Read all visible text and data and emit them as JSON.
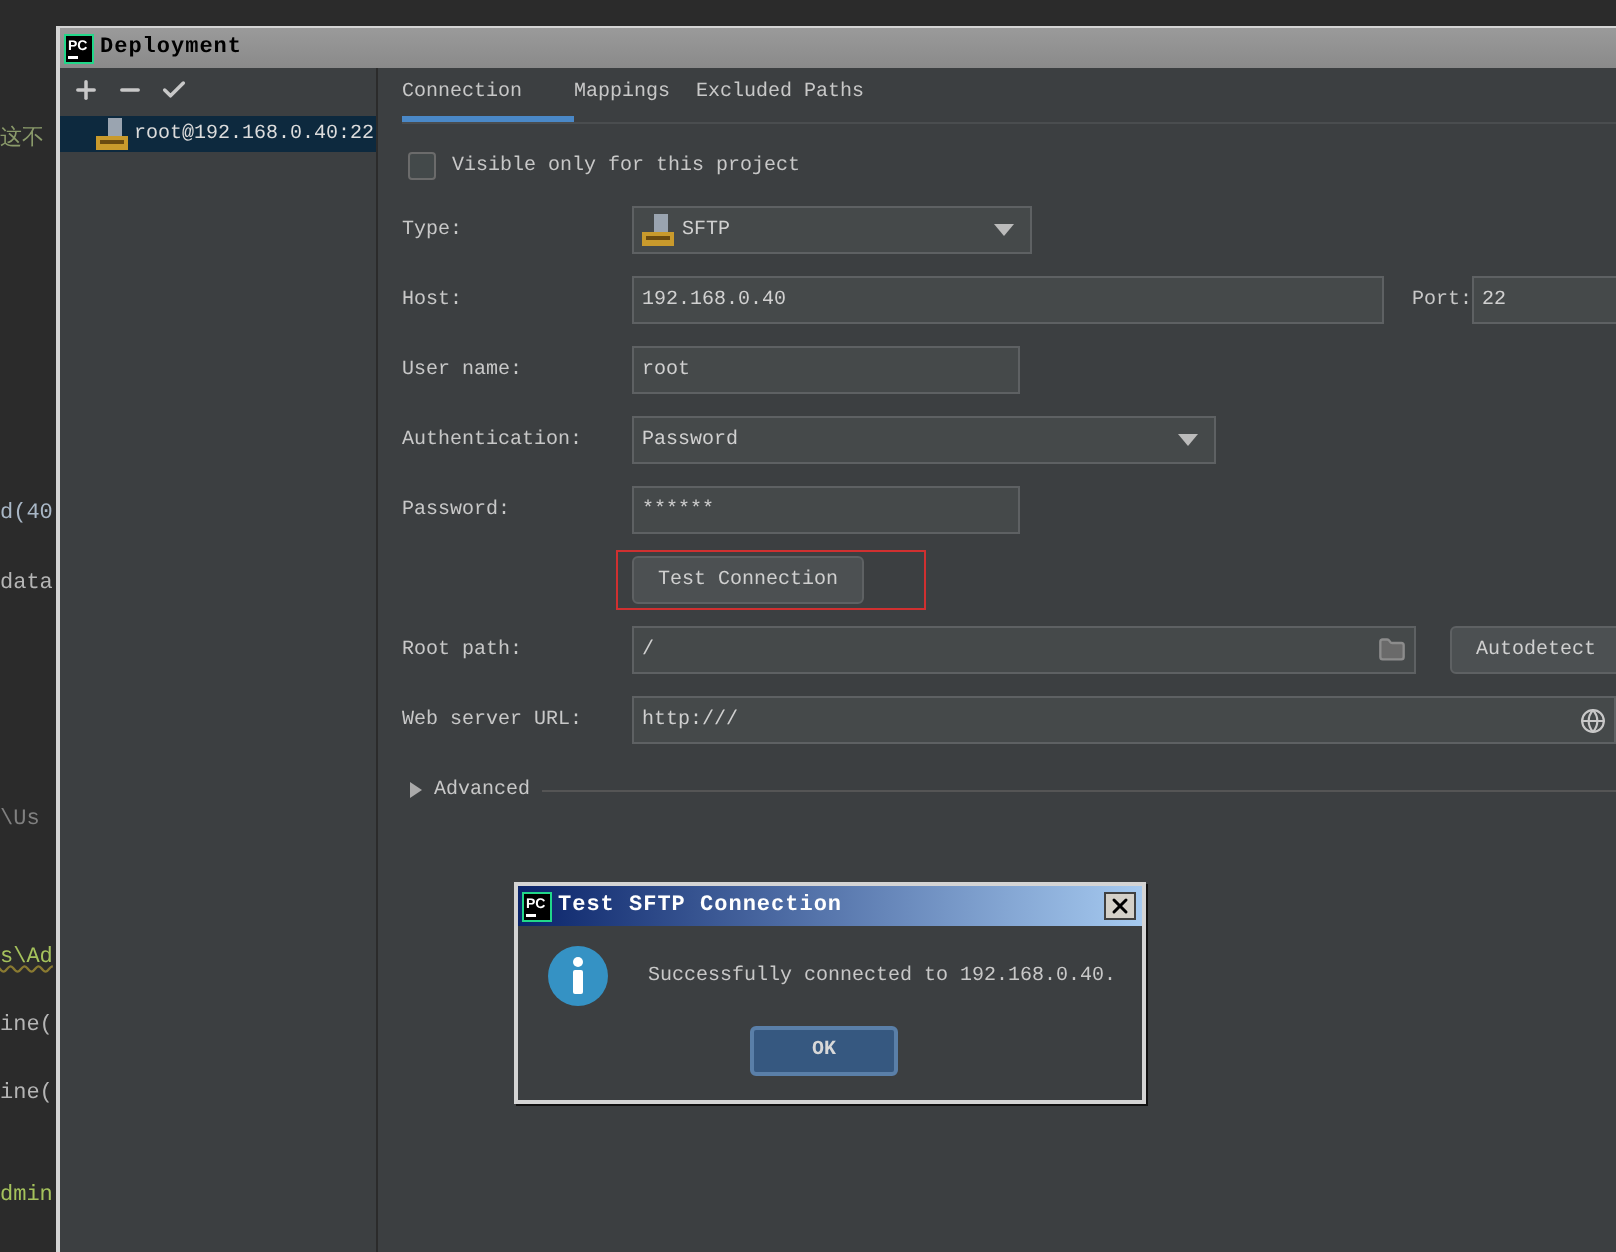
{
  "editor": {
    "fragments": [
      {
        "text": "这不",
        "kind": "comment"
      },
      {
        "text": "d(40",
        "kind": "call"
      },
      {
        "text": "data",
        "kind": "plain"
      },
      {
        "text": "\\Us",
        "kind": "path"
      },
      {
        "text": "s\\Ad",
        "kind": "string"
      },
      {
        "text": "ine(",
        "kind": "plain"
      },
      {
        "text": "ine(",
        "kind": "plain"
      },
      {
        "text": "dmin",
        "kind": "string"
      }
    ]
  },
  "window": {
    "title": "Deployment",
    "logo": "PC"
  },
  "sidebar": {
    "items": [
      {
        "label": "root@192.168.0.40:22",
        "selected": true
      }
    ]
  },
  "tabs": [
    {
      "label": "Connection",
      "selected": true
    },
    {
      "label": "Mappings",
      "selected": false
    },
    {
      "label": "Excluded Paths",
      "selected": false
    }
  ],
  "fields": [
    {
      "kind": "checkbox",
      "label": "Visible only for this project",
      "checked": false
    },
    {
      "kind": "protocol_select",
      "label": "Type:",
      "value": "SFTP"
    },
    {
      "kind": "host",
      "label": "Host:",
      "value": "192.168.0.40",
      "port_label": "Port:",
      "port": "22"
    },
    {
      "kind": "text",
      "label": "User name:",
      "value": "root"
    },
    {
      "kind": "select",
      "label": "Authentication:",
      "value": "Password"
    },
    {
      "kind": "text",
      "label": "Password:",
      "value": "******"
    },
    {
      "kind": "button",
      "label": "Test Connection",
      "highlighted": true
    },
    {
      "kind": "path",
      "label": "Root path:",
      "value": "/",
      "button": "Autodetect"
    },
    {
      "kind": "url",
      "label": "Web server URL:",
      "value": "http:///"
    },
    {
      "kind": "section",
      "label": "Advanced",
      "expanded": false
    }
  ],
  "dialog": {
    "logo": "PC",
    "title": "Test SFTP Connection",
    "message": "Successfully connected to 192.168.0.40.",
    "button": "OK"
  }
}
